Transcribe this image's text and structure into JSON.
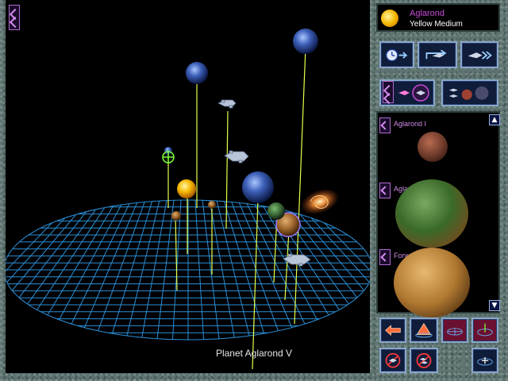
{
  "star": {
    "name": "Aglarond",
    "class": "Yellow Medium",
    "icon": "sun-icon"
  },
  "viewport": {
    "selected_label": "Planet Aglarond V"
  },
  "system_list": {
    "items": [
      {
        "label": "Aglarond I",
        "icon": "planet-icon"
      },
      {
        "label": "Aglarond III",
        "icon": "planet-icon"
      },
      {
        "label": "Forward Station",
        "icon": "planet-icon"
      }
    ],
    "scroll_up_glyph": "▲",
    "scroll_down_glyph": "▼"
  },
  "toolbar": {
    "row1": [
      "clock-advance-icon",
      "fleet-transfer-icon",
      "fleet-fast-forward-icon"
    ],
    "row2": [
      "cycle-ships-icon",
      "ships-to-planets-icon"
    ],
    "bottom": [
      "grid-prev-icon",
      "grid-elevate-icon",
      "grid-icon",
      "grid-center-icon",
      "no-ships-icon",
      "no-fleets-icon",
      "grid-zoom-icon"
    ]
  },
  "colors": {
    "grid": "#2a8fd8",
    "stalk": "#e8ff4a",
    "accent": "#c84ad8",
    "frame": "#5f7572"
  }
}
